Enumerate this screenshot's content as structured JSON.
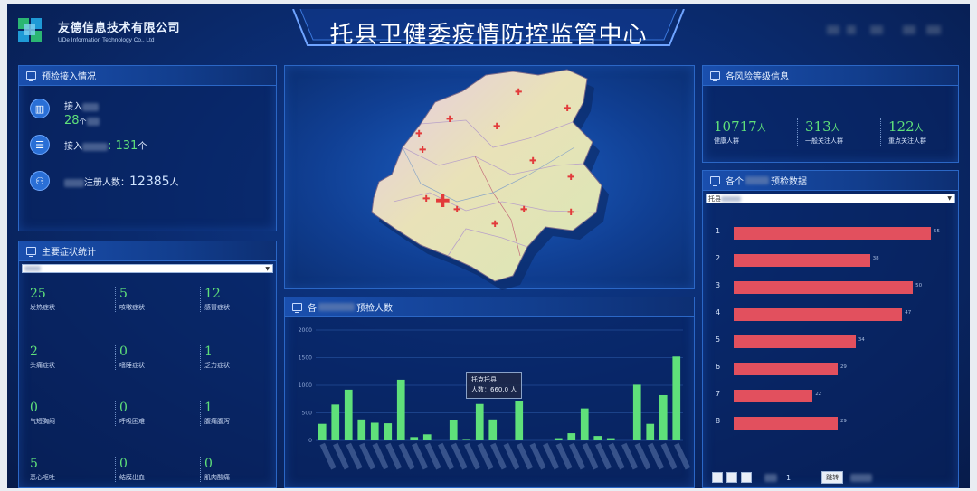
{
  "header": {
    "company_cn": "友德信息技术有限公司",
    "company_en": "UDe Information Technology Co., Ltd",
    "title": "托县卫健委疫情防控监管中心"
  },
  "access": {
    "title": "预检接入情况",
    "row1_label": "接入",
    "row1_value": "28",
    "row1_unit": "个",
    "row2_label": "接入",
    "row2_value": "131",
    "row2_unit": "个",
    "row3_label": "注册人数：",
    "row3_value": "12385",
    "row3_unit": "人"
  },
  "symptoms": {
    "title": "主要症状统计",
    "items": [
      {
        "value": "25",
        "label": "发热症状"
      },
      {
        "value": "5",
        "label": "咳嗽症状"
      },
      {
        "value": "12",
        "label": "感冒症状"
      },
      {
        "value": "2",
        "label": "头痛症状"
      },
      {
        "value": "0",
        "label": "嗜睡症状"
      },
      {
        "value": "1",
        "label": "乏力症状"
      },
      {
        "value": "0",
        "label": "气短胸闷"
      },
      {
        "value": "0",
        "label": "呼吸困难"
      },
      {
        "value": "1",
        "label": "腹痛腹泻"
      },
      {
        "value": "5",
        "label": "恶心呕吐"
      },
      {
        "value": "0",
        "label": "结膜出血"
      },
      {
        "value": "0",
        "label": "肌肉酸痛"
      }
    ]
  },
  "risk": {
    "title": "各风险等级信息",
    "items": [
      {
        "value": "10717",
        "unit": "人",
        "label": "健康人群"
      },
      {
        "value": "313",
        "unit": "人",
        "label": "一般关注人群"
      },
      {
        "value": "122",
        "unit": "人",
        "label": "重点关注人群"
      }
    ]
  },
  "ranking": {
    "title_pre": "各个",
    "title_post": "预检数据",
    "select_value": "托县",
    "page": "1",
    "go_label": "跳转"
  },
  "bar_panel": {
    "title_pre": "各",
    "title_post": "预检人数",
    "tooltip_line1": "托克托县",
    "tooltip_line2": "人数：660.0 人"
  },
  "colors": {
    "green": "#5fe07a",
    "red": "#e2505e",
    "panel_border": "#2b67c6"
  },
  "icons": [
    "building-icon",
    "list-icon",
    "users-icon",
    "monitor-icon",
    "red-cross-icon"
  ],
  "chart_data": [
    {
      "type": "bar",
      "title": "各预检人数",
      "y_ticks": [
        "0",
        "500",
        "1000",
        "1500",
        "2000"
      ],
      "ylim": [
        0,
        2000
      ],
      "grid": true,
      "tooltip_value": 660,
      "values": [
        300,
        650,
        920,
        380,
        320,
        310,
        1100,
        60,
        110,
        0,
        370,
        10,
        660,
        380,
        0,
        720,
        0,
        0,
        40,
        130,
        580,
        80,
        40,
        0,
        1010,
        300,
        820,
        1520
      ]
    },
    {
      "type": "bar",
      "orientation": "horizontal",
      "title": "各个预检数据",
      "categories": [
        "1",
        "2",
        "3",
        "4",
        "5",
        "6",
        "7",
        "8"
      ],
      "values": [
        55,
        38,
        50,
        47,
        34,
        29,
        22,
        29
      ],
      "xlim": [
        0,
        55
      ]
    }
  ]
}
